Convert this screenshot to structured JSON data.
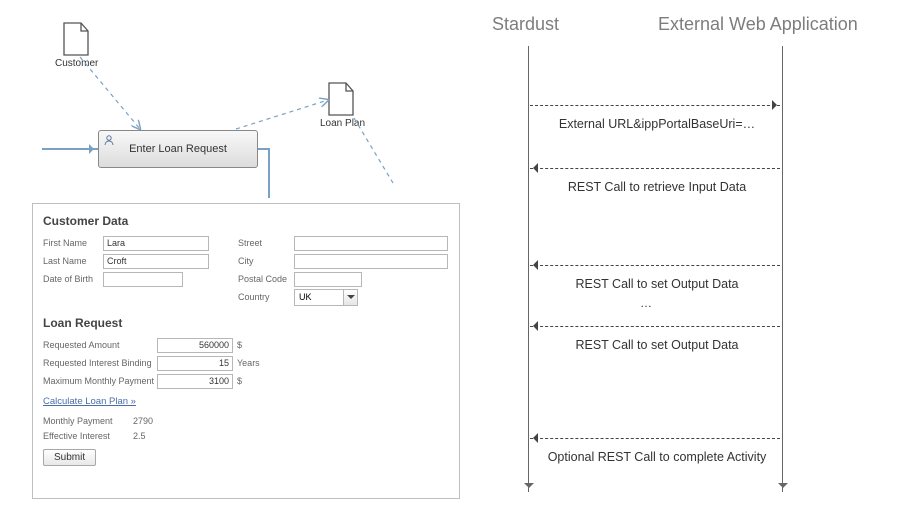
{
  "diagram": {
    "customer_label": "Customer",
    "loanplan_label": "Loan Plan",
    "activity_label": "Enter Loan Request"
  },
  "form": {
    "section1": "Customer Data",
    "first_name_label": "First Name",
    "first_name": "Lara",
    "last_name_label": "Last Name",
    "last_name": "Croft",
    "dob_label": "Date of Birth",
    "dob": "",
    "street_label": "Street",
    "street": "",
    "city_label": "City",
    "city": "",
    "postal_label": "Postal Code",
    "postal": "",
    "country_label": "Country",
    "country_selected": "UK",
    "section2": "Loan Request",
    "req_amount_label": "Requested Amount",
    "req_amount": "560000",
    "req_amount_unit": "$",
    "req_binding_label": "Requested Interest Binding",
    "req_binding": "15",
    "req_binding_unit": "Years",
    "max_pay_label": "Maximum Monthly Payment",
    "max_pay": "3100",
    "max_pay_unit": "$",
    "calc_link": "Calculate Loan Plan »",
    "monthly_payment_label": "Monthly Payment",
    "monthly_payment": "2790",
    "effective_interest_label": "Effective Interest",
    "effective_interest": "2.5",
    "submit": "Submit"
  },
  "seq": {
    "left_title": "Stardust",
    "right_title": "External Web Application",
    "m1": "External URL&ippPortalBaseUri=…",
    "m2": "REST Call to retrieve Input Data",
    "m3": "REST Call to set Output Data",
    "ellipsis": "…",
    "m4": "REST Call to set Output Data",
    "m5": "Optional REST Call to complete Activity"
  }
}
